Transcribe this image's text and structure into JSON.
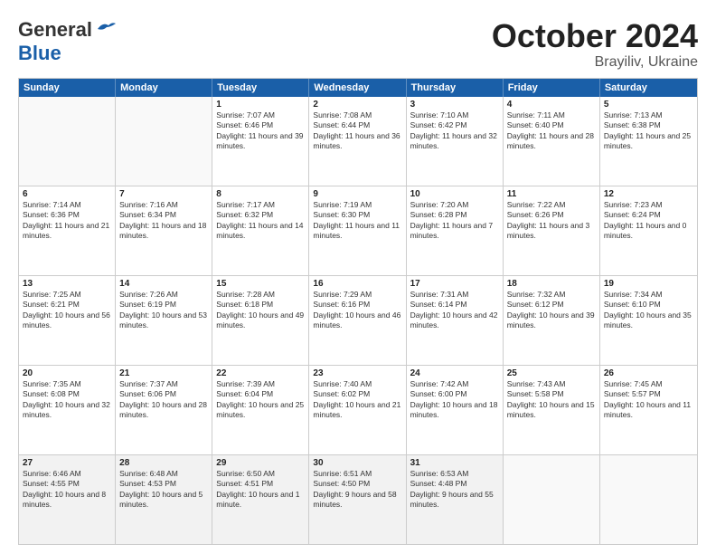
{
  "header": {
    "logo": {
      "line1": "General",
      "line2": "Blue"
    },
    "month": "October 2024",
    "location": "Brayiliv, Ukraine"
  },
  "weekdays": [
    "Sunday",
    "Monday",
    "Tuesday",
    "Wednesday",
    "Thursday",
    "Friday",
    "Saturday"
  ],
  "rows": [
    [
      {
        "day": "",
        "info": "",
        "empty": true
      },
      {
        "day": "",
        "info": "",
        "empty": true
      },
      {
        "day": "1",
        "info": "Sunrise: 7:07 AM\nSunset: 6:46 PM\nDaylight: 11 hours and 39 minutes."
      },
      {
        "day": "2",
        "info": "Sunrise: 7:08 AM\nSunset: 6:44 PM\nDaylight: 11 hours and 36 minutes."
      },
      {
        "day": "3",
        "info": "Sunrise: 7:10 AM\nSunset: 6:42 PM\nDaylight: 11 hours and 32 minutes."
      },
      {
        "day": "4",
        "info": "Sunrise: 7:11 AM\nSunset: 6:40 PM\nDaylight: 11 hours and 28 minutes."
      },
      {
        "day": "5",
        "info": "Sunrise: 7:13 AM\nSunset: 6:38 PM\nDaylight: 11 hours and 25 minutes."
      }
    ],
    [
      {
        "day": "6",
        "info": "Sunrise: 7:14 AM\nSunset: 6:36 PM\nDaylight: 11 hours and 21 minutes."
      },
      {
        "day": "7",
        "info": "Sunrise: 7:16 AM\nSunset: 6:34 PM\nDaylight: 11 hours and 18 minutes."
      },
      {
        "day": "8",
        "info": "Sunrise: 7:17 AM\nSunset: 6:32 PM\nDaylight: 11 hours and 14 minutes."
      },
      {
        "day": "9",
        "info": "Sunrise: 7:19 AM\nSunset: 6:30 PM\nDaylight: 11 hours and 11 minutes."
      },
      {
        "day": "10",
        "info": "Sunrise: 7:20 AM\nSunset: 6:28 PM\nDaylight: 11 hours and 7 minutes."
      },
      {
        "day": "11",
        "info": "Sunrise: 7:22 AM\nSunset: 6:26 PM\nDaylight: 11 hours and 3 minutes."
      },
      {
        "day": "12",
        "info": "Sunrise: 7:23 AM\nSunset: 6:24 PM\nDaylight: 11 hours and 0 minutes."
      }
    ],
    [
      {
        "day": "13",
        "info": "Sunrise: 7:25 AM\nSunset: 6:21 PM\nDaylight: 10 hours and 56 minutes."
      },
      {
        "day": "14",
        "info": "Sunrise: 7:26 AM\nSunset: 6:19 PM\nDaylight: 10 hours and 53 minutes."
      },
      {
        "day": "15",
        "info": "Sunrise: 7:28 AM\nSunset: 6:18 PM\nDaylight: 10 hours and 49 minutes."
      },
      {
        "day": "16",
        "info": "Sunrise: 7:29 AM\nSunset: 6:16 PM\nDaylight: 10 hours and 46 minutes."
      },
      {
        "day": "17",
        "info": "Sunrise: 7:31 AM\nSunset: 6:14 PM\nDaylight: 10 hours and 42 minutes."
      },
      {
        "day": "18",
        "info": "Sunrise: 7:32 AM\nSunset: 6:12 PM\nDaylight: 10 hours and 39 minutes."
      },
      {
        "day": "19",
        "info": "Sunrise: 7:34 AM\nSunset: 6:10 PM\nDaylight: 10 hours and 35 minutes."
      }
    ],
    [
      {
        "day": "20",
        "info": "Sunrise: 7:35 AM\nSunset: 6:08 PM\nDaylight: 10 hours and 32 minutes."
      },
      {
        "day": "21",
        "info": "Sunrise: 7:37 AM\nSunset: 6:06 PM\nDaylight: 10 hours and 28 minutes."
      },
      {
        "day": "22",
        "info": "Sunrise: 7:39 AM\nSunset: 6:04 PM\nDaylight: 10 hours and 25 minutes."
      },
      {
        "day": "23",
        "info": "Sunrise: 7:40 AM\nSunset: 6:02 PM\nDaylight: 10 hours and 21 minutes."
      },
      {
        "day": "24",
        "info": "Sunrise: 7:42 AM\nSunset: 6:00 PM\nDaylight: 10 hours and 18 minutes."
      },
      {
        "day": "25",
        "info": "Sunrise: 7:43 AM\nSunset: 5:58 PM\nDaylight: 10 hours and 15 minutes."
      },
      {
        "day": "26",
        "info": "Sunrise: 7:45 AM\nSunset: 5:57 PM\nDaylight: 10 hours and 11 minutes."
      }
    ],
    [
      {
        "day": "27",
        "info": "Sunrise: 6:46 AM\nSunset: 4:55 PM\nDaylight: 10 hours and 8 minutes."
      },
      {
        "day": "28",
        "info": "Sunrise: 6:48 AM\nSunset: 4:53 PM\nDaylight: 10 hours and 5 minutes."
      },
      {
        "day": "29",
        "info": "Sunrise: 6:50 AM\nSunset: 4:51 PM\nDaylight: 10 hours and 1 minute."
      },
      {
        "day": "30",
        "info": "Sunrise: 6:51 AM\nSunset: 4:50 PM\nDaylight: 9 hours and 58 minutes."
      },
      {
        "day": "31",
        "info": "Sunrise: 6:53 AM\nSunset: 4:48 PM\nDaylight: 9 hours and 55 minutes."
      },
      {
        "day": "",
        "info": "",
        "empty": true
      },
      {
        "day": "",
        "info": "",
        "empty": true
      }
    ]
  ]
}
